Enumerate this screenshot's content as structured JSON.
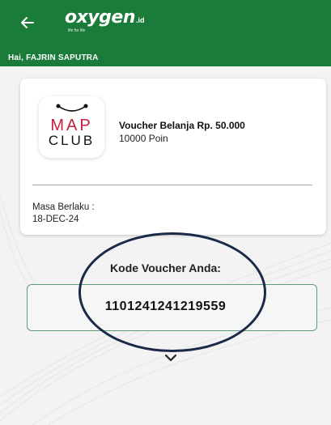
{
  "header": {
    "logo": {
      "main": "oxygen",
      "suffix": ".id",
      "tagline": "life for life"
    },
    "greeting": "Hai, FAJRIN SAPUTRA"
  },
  "voucher_card": {
    "brand": {
      "line1": "MAP",
      "line2": "CLUB"
    },
    "title": "Voucher Belanja Rp. 50.000",
    "points": "10000 Poin",
    "validity_label": "Masa Berlaku :",
    "validity_value": "18-DEC-24"
  },
  "voucher_code": {
    "label": "Kode Voucher Anda:",
    "value": "1101241241219559"
  },
  "colors": {
    "header_green": "#1a7b3a",
    "code_border": "#5e9b77",
    "brand_red": "#c5203e",
    "annotation_ellipse": "#1b2a48"
  },
  "icons": {
    "back": "arrow-left-icon",
    "expand": "chevron-down-icon",
    "bag_handle": "bag-handle-icon"
  }
}
